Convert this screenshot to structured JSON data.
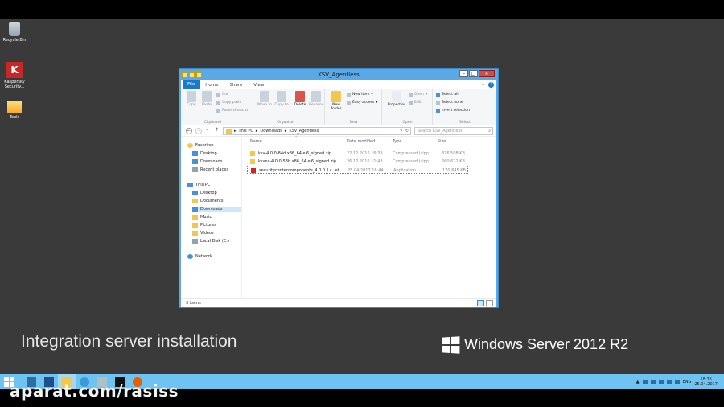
{
  "desktop": {
    "icons": [
      {
        "label": "Recycle Bin",
        "icon": "recycle-bin-icon"
      },
      {
        "label": "Kaspersky Security...",
        "icon": "kaspersky-icon"
      },
      {
        "label": "Tools",
        "icon": "folder-icon"
      }
    ],
    "caption": "Integration server installation",
    "brand": "Windows Server 2012 R2",
    "watermark": "aparat.com/rasiss"
  },
  "window": {
    "title": "KSV_Agentless",
    "menu": {
      "file": "File",
      "tabs": [
        "Home",
        "Share",
        "View"
      ]
    },
    "ribbon": {
      "clipboard": {
        "label": "Clipboard",
        "copy": "Copy",
        "paste": "Paste",
        "cut": "Cut",
        "copy_path": "Copy path",
        "paste_shortcut": "Paste shortcut"
      },
      "organize": {
        "label": "Organize",
        "move_to": "Move to",
        "copy_to": "Copy to",
        "delete": "Delete",
        "rename": "Rename"
      },
      "new": {
        "label": "New",
        "new_folder": "New folder",
        "new_item": "New item",
        "easy_access": "Easy access"
      },
      "open": {
        "label": "Open",
        "properties": "Properties",
        "open": "Open",
        "edit": "Edit"
      },
      "select": {
        "label": "Select",
        "select_all": "Select all",
        "select_none": "Select none",
        "invert": "Invert selection"
      }
    },
    "address": {
      "path": [
        "This PC",
        "Downloads",
        "KSV_Agentless"
      ],
      "search_placeholder": "Search KSV_Agentless"
    },
    "nav": {
      "favorites": "Favorites",
      "favorite_items": [
        "Desktop",
        "Downloads",
        "Recent places"
      ],
      "this_pc": "This PC",
      "pc_items": [
        "Desktop",
        "Documents",
        "Downloads",
        "Music",
        "Pictures",
        "Videos",
        "Local Disk (C:)"
      ],
      "network": "Network"
    },
    "columns": {
      "name": "Name",
      "date": "Date modified",
      "type": "Type",
      "size": "Size"
    },
    "files": [
      {
        "name": "ksv-4.0.0-84d.x86_64.el6_signed.zip",
        "date": "22.12.2016 16:33",
        "type": "Compressed (zipp...",
        "size": "876 508 KB",
        "icon": "zip-folder-icon"
      },
      {
        "name": "ksvns-4.0.0-53b.x86_64.el6_signed.zip",
        "date": "26.12.2016 11:43",
        "type": "Compressed (zipp...",
        "size": "660 622 KB",
        "icon": "zip-folder-icon"
      },
      {
        "name": "securitycentercomponents_4.0.0.11...et...",
        "date": "25.04.2017 16:44",
        "type": "Application",
        "size": "170 845 KB",
        "icon": "application-icon"
      }
    ],
    "status": "3 items"
  },
  "taskbar": {
    "tray": {
      "lang": "ENG",
      "time": "18:35",
      "date": "25.04.2017"
    }
  },
  "colors": {
    "taskbar": "#6ec3f1",
    "window_frame": "#5aa9e6",
    "file_tab": "#1979ca",
    "desktop": "#3a3a3a"
  }
}
